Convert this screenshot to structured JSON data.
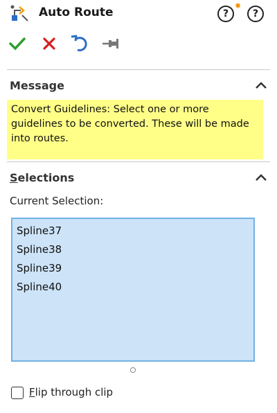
{
  "header": {
    "title": "Auto Route",
    "feature_icon": "auto-route-icon",
    "help_icons": [
      "whats-wrong-help-icon",
      "help-icon"
    ]
  },
  "actions": {
    "ok": "ok-checkmark-icon",
    "cancel": "cancel-x-icon",
    "undo": "undo-icon",
    "pin": "pushpin-icon"
  },
  "message": {
    "group_title": "Message",
    "text": "Convert Guidelines: Select one or more guidelines to be converted. These will be made into routes."
  },
  "selections": {
    "group_title": "Selections",
    "current_label": "Current Selection:",
    "items": [
      "Spline37",
      "Spline38",
      "Spline39",
      "Spline40"
    ]
  },
  "options": {
    "flip_label": "Flip through clip",
    "flip_checked": false
  },
  "colors": {
    "message_bg": "#ffff88",
    "selection_bg": "#cde3f7",
    "selection_border": "#6fb1e6",
    "ok_green": "#2e9e2e",
    "cancel_red": "#d42020",
    "undo_blue": "#2a6fc4"
  }
}
